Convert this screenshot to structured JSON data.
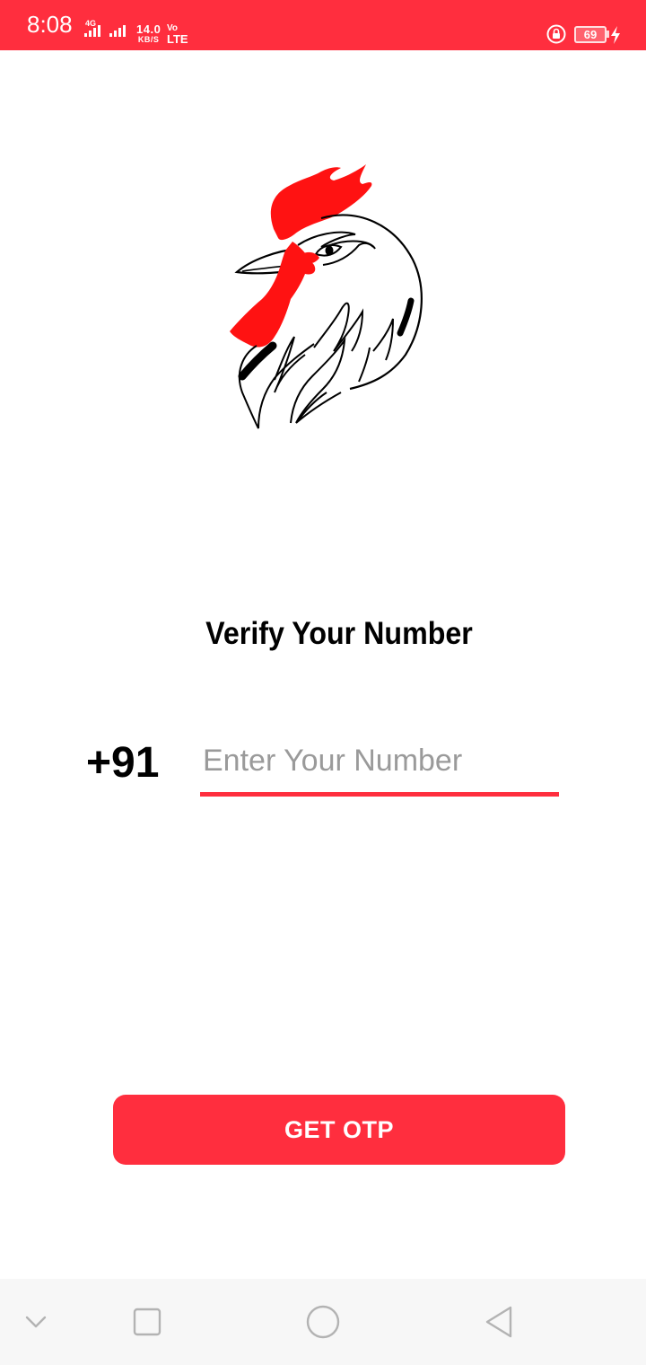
{
  "status_bar": {
    "time": "8:08",
    "network_label": "4G",
    "speed_value": "14.0",
    "speed_unit": "KB/S",
    "volte_top": "Vo",
    "volte_bottom": "LTE",
    "battery_level": "69",
    "background_color": "#ff2e3e"
  },
  "logo": {
    "icon": "rooster-head-icon"
  },
  "main": {
    "title": "Verify Your Number",
    "country_code": "+91",
    "phone_input": {
      "value": "",
      "placeholder": "Enter Your Number"
    },
    "otp_button_label": "GET OTP"
  },
  "nav_bar": {
    "items": [
      {
        "icon": "chevron-down-icon"
      },
      {
        "icon": "square-recents-icon"
      },
      {
        "icon": "circle-home-icon"
      },
      {
        "icon": "triangle-back-icon"
      }
    ]
  },
  "colors": {
    "accent": "#ff2e3e",
    "placeholder": "#9a9a9a",
    "nav_background": "#f7f7f7"
  }
}
